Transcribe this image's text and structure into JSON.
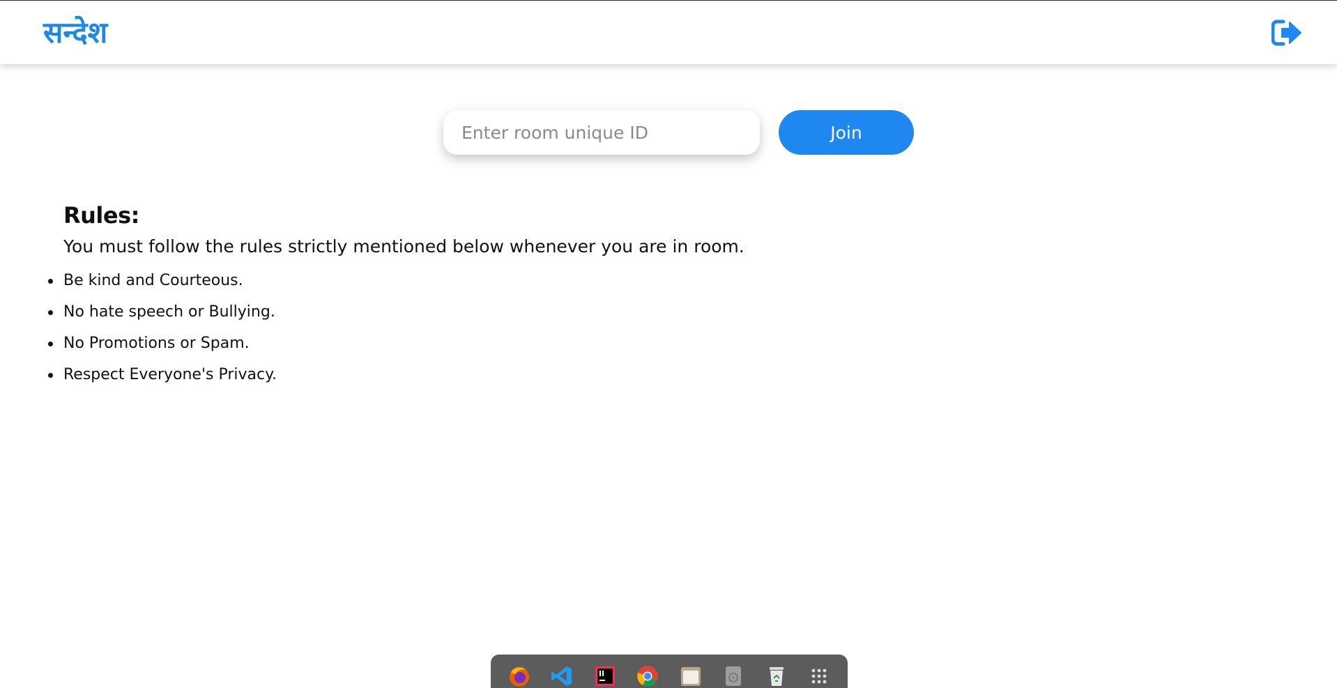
{
  "header": {
    "brand": "सन्देश",
    "logout_icon": "logout-icon"
  },
  "join": {
    "input_placeholder": "Enter room unique ID",
    "input_value": "",
    "button_label": "Join"
  },
  "rules": {
    "title": "Rules:",
    "intro": "You must follow the rules strictly mentioned below whenever you are in room.",
    "items": [
      "Be kind and Courteous.",
      "No hate speech or Bullying.",
      "No Promotions or Spam.",
      "Respect Everyone's Privacy."
    ]
  },
  "dock": {
    "icons": [
      "firefox-icon",
      "vscode-icon",
      "intellij-icon",
      "chrome-icon",
      "files-icon",
      "disk-icon",
      "trash-icon",
      "app-grid-icon"
    ]
  },
  "colors": {
    "accent": "#1e88f0",
    "brand": "#1e88e5",
    "dock_bg": "#5c5c5c"
  }
}
